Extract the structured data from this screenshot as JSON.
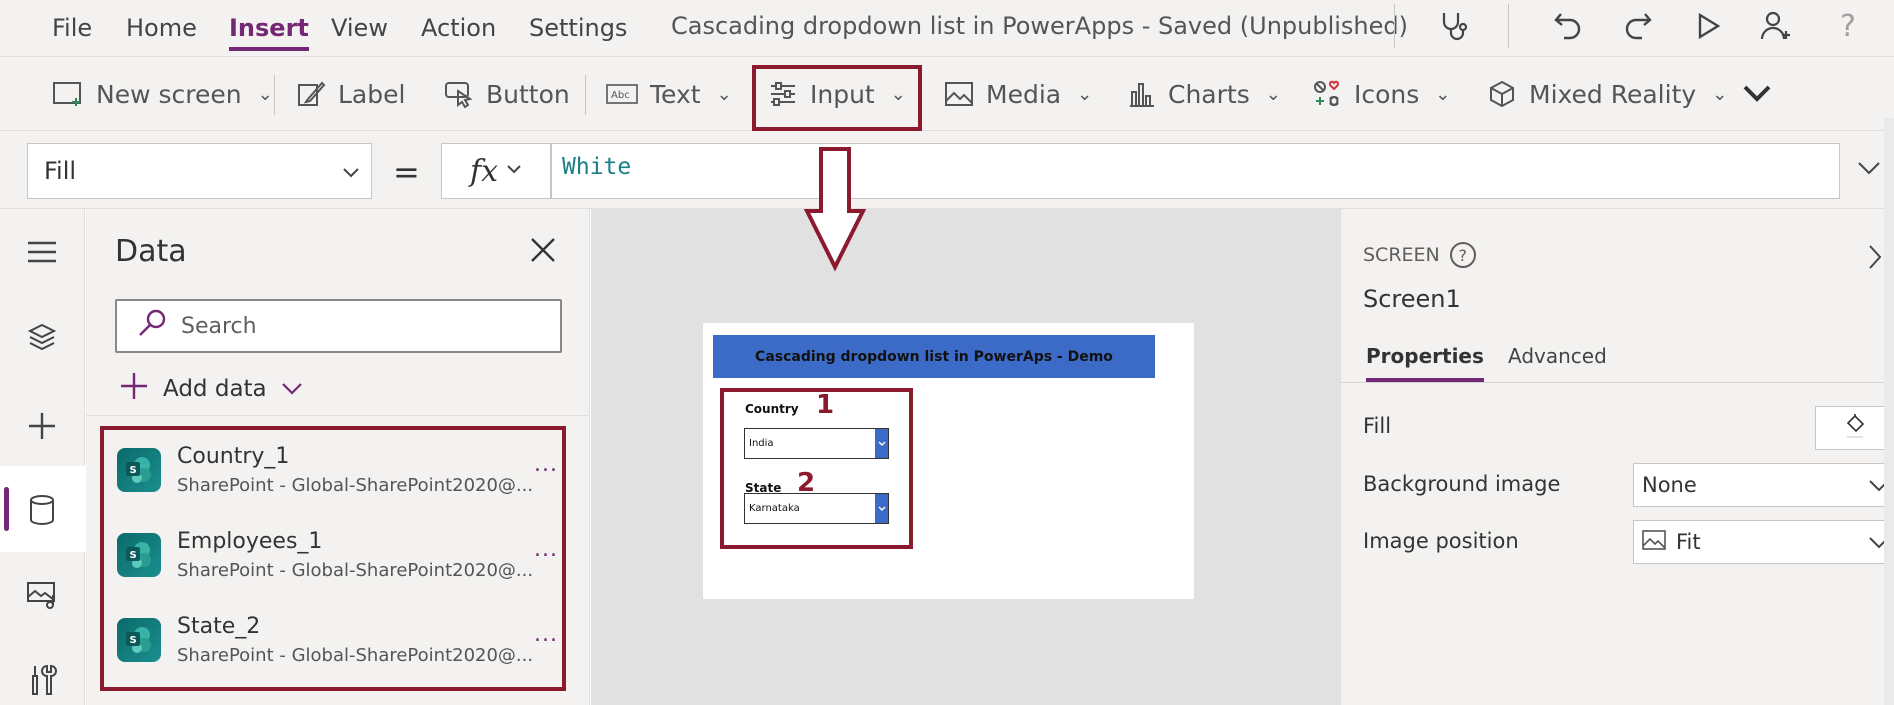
{
  "menu": {
    "items": [
      "File",
      "Home",
      "Insert",
      "View",
      "Action",
      "Settings"
    ],
    "active": "Insert"
  },
  "app_title": "Cascading dropdown list in PowerApps - Saved (Unpublished)",
  "top_icons": [
    "stethoscope-icon",
    "undo-icon",
    "redo-icon",
    "play-icon",
    "add-user-icon",
    "help-icon"
  ],
  "ribbon": {
    "new_screen": "New screen",
    "label": "Label",
    "button": "Button",
    "text": "Text",
    "input": "Input",
    "media": "Media",
    "charts": "Charts",
    "icons": "Icons",
    "mixed_reality": "Mixed Reality"
  },
  "formula_bar": {
    "property": "Fill",
    "equals": "=",
    "fx": "fx",
    "formula": "White"
  },
  "rail_icons": [
    "hamburger-icon",
    "layers-icon",
    "plus-icon",
    "database-icon",
    "media-icon",
    "tools-icon"
  ],
  "data_pane": {
    "title": "Data",
    "search_placeholder": "Search",
    "add_data": "Add data",
    "sources": [
      {
        "name": "Country_1",
        "subtitle": "SharePoint - Global-SharePoint2020@..."
      },
      {
        "name": "Employees_1",
        "subtitle": "SharePoint - Global-SharePoint2020@..."
      },
      {
        "name": "State_2",
        "subtitle": "SharePoint - Global-SharePoint2020@..."
      }
    ],
    "more": "..."
  },
  "canvas": {
    "banner": "Cascading dropdown list in PowerAps - Demo",
    "country_label": "Country",
    "country_value": "India",
    "state_label": "State",
    "state_value": "Karnataka",
    "annotation_1": "1",
    "annotation_2": "2"
  },
  "properties": {
    "kind": "SCREEN",
    "help": "?",
    "name": "Screen1",
    "tabs": [
      "Properties",
      "Advanced"
    ],
    "active_tab": "Properties",
    "fill_label": "Fill",
    "bg_image_label": "Background image",
    "bg_image_value": "None",
    "image_position_label": "Image position",
    "image_position_value": "Fit"
  },
  "colors": {
    "accent": "#742774",
    "annotation": "#8b1a2f",
    "banner": "#3c6bc7",
    "formula_text": "#1a7f86"
  }
}
